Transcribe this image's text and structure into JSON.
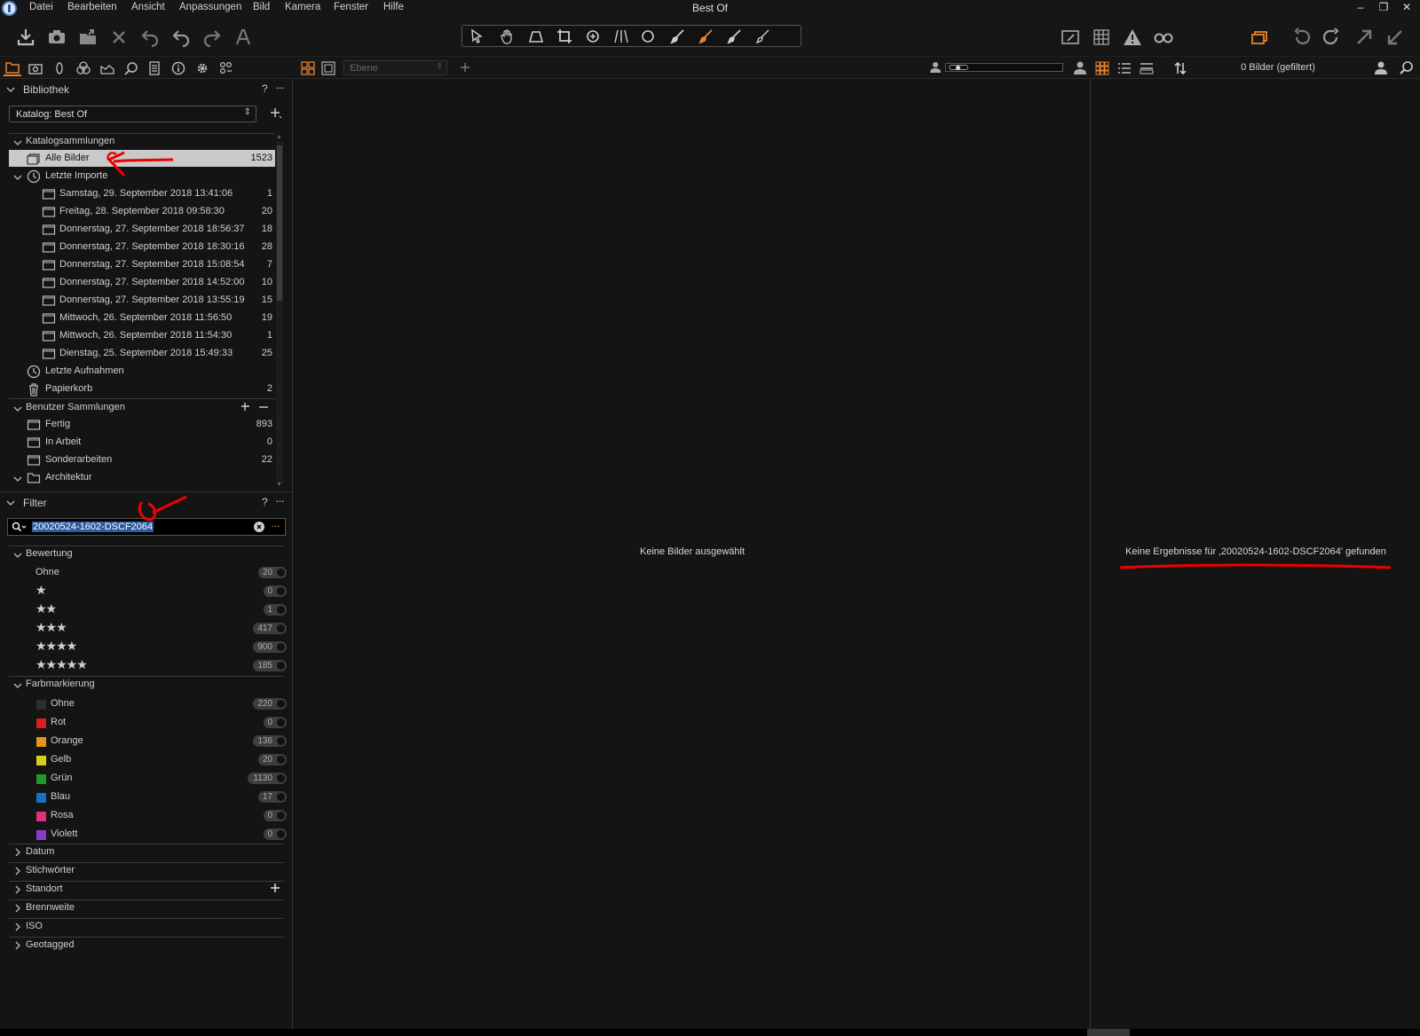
{
  "app": {
    "title": "Best Of",
    "menu": [
      "Datei",
      "Bearbeiten",
      "Ansicht",
      "Anpassungen",
      "Bild",
      "Kamera",
      "Fenster",
      "Hilfe"
    ],
    "window_controls": [
      "–",
      "❐",
      "✕"
    ]
  },
  "toolbar": {
    "left_icons": [
      "import-icon",
      "camera-icon",
      "export-icon",
      "delete-icon",
      "undo-all-icon",
      "undo-icon",
      "redo-icon",
      "text-icon"
    ],
    "cursor_tools": [
      "select-icon",
      "pan-icon",
      "keystone-icon",
      "crop-icon",
      "rotate-icon",
      "straighten-icon",
      "circle-icon",
      "brush-icon",
      "brush-active-icon",
      "eraser-icon",
      "gradient-icon"
    ],
    "right_icons": [
      "edit-icon",
      "grid-icon",
      "warning-icon",
      "glasses-icon",
      "copy-adjustments-icon",
      "rotate-left-icon",
      "rotate-right-icon",
      "apply-icon",
      "reset-icon"
    ],
    "accent_color": "#e8832a"
  },
  "library": {
    "title": "Bibliothek",
    "help": "?",
    "more": "···",
    "catalog_label": "Katalog: Best Of",
    "catalog_collections": {
      "title": "Katalogsammlungen",
      "all_images": {
        "label": "Alle Bilder",
        "count": "1523"
      },
      "recent_imports": {
        "label": "Letzte Importe",
        "items": [
          {
            "label": "Samstag, 29. September 2018 13:41:06",
            "count": "1"
          },
          {
            "label": "Freitag, 28. September 2018 09:58:30",
            "count": "20"
          },
          {
            "label": "Donnerstag, 27. September 2018 18:56:37",
            "count": "18"
          },
          {
            "label": "Donnerstag, 27. September 2018 18:30:16",
            "count": "28"
          },
          {
            "label": "Donnerstag, 27. September 2018 15:08:54",
            "count": "7"
          },
          {
            "label": "Donnerstag, 27. September 2018 14:52:00",
            "count": "10"
          },
          {
            "label": "Donnerstag, 27. September 2018 13:55:19",
            "count": "15"
          },
          {
            "label": "Mittwoch, 26. September 2018 11:56:50",
            "count": "19"
          },
          {
            "label": "Mittwoch, 26. September 2018 11:54:30",
            "count": "1"
          },
          {
            "label": "Dienstag, 25. September 2018 15:49:33",
            "count": "25"
          }
        ]
      },
      "recent_captures": {
        "label": "Letzte Aufnahmen"
      },
      "trash": {
        "label": "Papierkorb",
        "count": "2"
      }
    },
    "user_collections": {
      "title": "Benutzer Sammlungen",
      "items": [
        {
          "label": "Fertig",
          "count": "893"
        },
        {
          "label": "In Arbeit",
          "count": "0"
        },
        {
          "label": "Sonderarbeiten",
          "count": "22"
        },
        {
          "label": "Architektur",
          "count": ""
        }
      ]
    }
  },
  "filter": {
    "title": "Filter",
    "help": "?",
    "more": "···",
    "search_value": "20020524-1602-DSCF2064",
    "rating": {
      "title": "Bewertung",
      "items": [
        {
          "label": "Ohne",
          "stars": "",
          "count": "20"
        },
        {
          "label": "",
          "stars": "★",
          "count": "0"
        },
        {
          "label": "",
          "stars": "★★",
          "count": "1"
        },
        {
          "label": "",
          "stars": "★★★",
          "count": "417"
        },
        {
          "label": "",
          "stars": "★★★★",
          "count": "900"
        },
        {
          "label": "",
          "stars": "★★★★★",
          "count": "185"
        }
      ]
    },
    "color": {
      "title": "Farbmarkierung",
      "items": [
        {
          "label": "Ohne",
          "color": "#2e2e2e",
          "count": "220"
        },
        {
          "label": "Rot",
          "color": "#d81e1e",
          "count": "0"
        },
        {
          "label": "Orange",
          "color": "#e8941c",
          "count": "136"
        },
        {
          "label": "Gelb",
          "color": "#d8cc16",
          "count": "20"
        },
        {
          "label": "Grün",
          "color": "#1e9a2c",
          "count": "1130"
        },
        {
          "label": "Blau",
          "color": "#1a70c8",
          "count": "17"
        },
        {
          "label": "Rosa",
          "color": "#e0307a",
          "count": "0"
        },
        {
          "label": "Violett",
          "color": "#8a3cc8",
          "count": "0"
        }
      ]
    },
    "collapsed": [
      "Datum",
      "Stichwörter",
      "Standort",
      "Brennweite",
      "ISO",
      "Geotagged"
    ]
  },
  "viewer": {
    "layer_placeholder": "Ebene",
    "empty_message": "Keine Bilder ausgewählt"
  },
  "browser": {
    "status": "0 Bilder (gefiltert)",
    "no_results": "Keine Ergebnisse für ‚20020524-1602-DSCF2064' gefunden"
  }
}
